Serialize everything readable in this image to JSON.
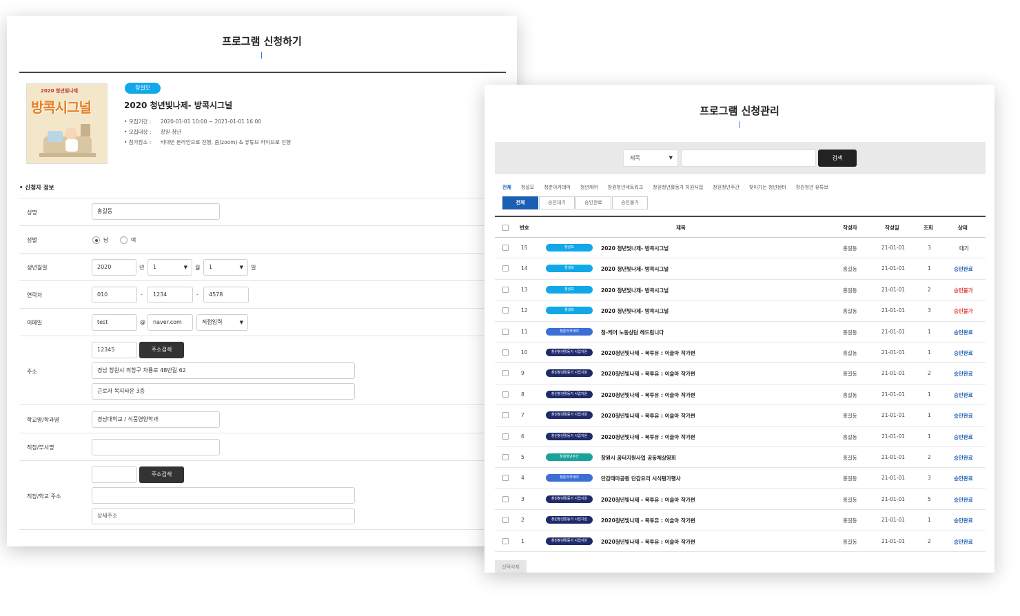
{
  "left": {
    "title": "프로그램 신청하기",
    "thumb_small": "2020 청년빛나제",
    "thumb_main": "방콕시그널",
    "badge": "청설모",
    "program_title": "2020 청년빛나제- 방콕시그널",
    "meta": [
      {
        "key": "모집기간 :",
        "value": "2020-01-01 10:00 ~ 2021-01-01 16:00"
      },
      {
        "key": "모집대상 :",
        "value": "창원 청년"
      },
      {
        "key": "참가장소 :",
        "value": "비대면 온라인으로 진행, 줌(zoom) & 유튜브 라이브로 진행"
      }
    ],
    "section_title": "신청자 정보",
    "labels": {
      "name": "성명",
      "gender": "성별",
      "birth": "생년월일",
      "phone": "연락처",
      "email": "이메일",
      "address": "주소",
      "school": "학교명/학과명",
      "work": "직장/부서명",
      "work_address": "직장/학교 주소"
    },
    "values": {
      "name": "홍길동",
      "gender_male": "남",
      "gender_female": "여",
      "birth_year": "2020",
      "birth_year_unit": "년",
      "birth_month": "1",
      "birth_month_unit": "월",
      "birth_day": "1",
      "birth_day_unit": "일",
      "phone1": "010",
      "phone2": "1234",
      "phone3": "4578",
      "phone_sep": "-",
      "email_id": "test",
      "email_at": "@",
      "email_domain": "naver.com",
      "email_select": "직접입력",
      "zipcode": "12345",
      "address_search": "주소검색",
      "address1": "경남 창원시 의창구 차룡로 48번길 62",
      "address2": "근로자 복지타운 3층",
      "school": "경남대학교 / 식품영양학과",
      "work": "",
      "work_zipcode": "",
      "work_address_search": "주소검색",
      "work_address1": "",
      "work_address2_placeholder": "상세주소"
    }
  },
  "right": {
    "title": "프로그램 신청관리",
    "search_select": "제목",
    "search_button": "검색",
    "categories": [
      "전체",
      "청설모",
      "청춘아카데미",
      "청년케어",
      "창원청년네트워크",
      "창원청년활동가 지원사업",
      "창원청년주간",
      "찾아가는 청년센터",
      "창원청년 유튜브"
    ],
    "status_tabs": [
      "전체",
      "승인대기",
      "승인완료",
      "승인불가"
    ],
    "headers": {
      "no": "번호",
      "title": "제목",
      "author": "작성자",
      "date": "작성일",
      "views": "조회",
      "status": "상태"
    },
    "rows": [
      {
        "no": "15",
        "badge": "청설모",
        "badge_color": "#10a8e8",
        "title": "2020 청년빛나제- 방콕시그널",
        "author": "홍길동",
        "date": "21-01-01",
        "views": "3",
        "status": "대기",
        "status_color": "#555555"
      },
      {
        "no": "14",
        "badge": "청설모",
        "badge_color": "#10a8e8",
        "title": "2020 청년빛나제- 방콕시그널",
        "author": "홍길동",
        "date": "21-01-01",
        "views": "1",
        "status": "승인완료",
        "status_color": "#1a5fb4"
      },
      {
        "no": "13",
        "badge": "청설모",
        "badge_color": "#10a8e8",
        "title": "2020 청년빛나제- 방콕시그널",
        "author": "홍길동",
        "date": "21-01-01",
        "views": "2",
        "status": "승인불가",
        "status_color": "#e53935"
      },
      {
        "no": "12",
        "badge": "청설모",
        "badge_color": "#10a8e8",
        "title": "2020 청년빛나제- 방콕시그널",
        "author": "홍길동",
        "date": "21-01-01",
        "views": "3",
        "status": "승인불가",
        "status_color": "#e53935"
      },
      {
        "no": "11",
        "badge": "청춘아카데미",
        "badge_color": "#3b6fd6",
        "title": "청-케어 노동상담 헤드립니다",
        "author": "홍길동",
        "date": "21-01-01",
        "views": "1",
        "status": "승인완료",
        "status_color": "#1a5fb4"
      },
      {
        "no": "10",
        "badge": "창원청년활동가 사업지원",
        "badge_color": "#1f2a6b",
        "title": "2020청년빛나제 - 북투유 : 이슬아 작가편",
        "author": "홍길동",
        "date": "21-01-01",
        "views": "1",
        "status": "승인완료",
        "status_color": "#1a5fb4"
      },
      {
        "no": "9",
        "badge": "창원청년활동가 사업지원",
        "badge_color": "#1f2a6b",
        "title": "2020청년빛나제 - 북투유 : 이슬아 작가편",
        "author": "홍길동",
        "date": "21-01-01",
        "views": "2",
        "status": "승인완료",
        "status_color": "#1a5fb4"
      },
      {
        "no": "8",
        "badge": "창원청년활동가 사업지원",
        "badge_color": "#1f2a6b",
        "title": "2020청년빛나제 - 북투유 : 이슬아 작가편",
        "author": "홍길동",
        "date": "21-01-01",
        "views": "1",
        "status": "승인완료",
        "status_color": "#1a5fb4"
      },
      {
        "no": "7",
        "badge": "창원청년활동가 사업지원",
        "badge_color": "#1f2a6b",
        "title": "2020청년빛나제 - 북투유 : 이슬아 작가편",
        "author": "홍길동",
        "date": "21-01-01",
        "views": "1",
        "status": "승인완료",
        "status_color": "#1a5fb4"
      },
      {
        "no": "6",
        "badge": "창원청년활동가 사업지원",
        "badge_color": "#1f2a6b",
        "title": "2020청년빛나제 - 북투유 : 이슬아 작가편",
        "author": "홍길동",
        "date": "21-01-01",
        "views": "1",
        "status": "승인완료",
        "status_color": "#1a5fb4"
      },
      {
        "no": "5",
        "badge": "창원청년주간",
        "badge_color": "#1aa39a",
        "title": "창원시 꿈터지원사업 공동체상영회",
        "author": "홍길동",
        "date": "21-01-01",
        "views": "2",
        "status": "승인완료",
        "status_color": "#1a5fb4"
      },
      {
        "no": "4",
        "badge": "청춘아카데미",
        "badge_color": "#3b6fd6",
        "title": "단감테마공원 단감요리 시식평가행사",
        "author": "홍길동",
        "date": "21-01-01",
        "views": "3",
        "status": "승인완료",
        "status_color": "#1a5fb4"
      },
      {
        "no": "3",
        "badge": "창원청년활동가 사업지원",
        "badge_color": "#1f2a6b",
        "title": "2020청년빛나제 - 북투유 : 이슬아 작가편",
        "author": "홍길동",
        "date": "21-01-01",
        "views": "5",
        "status": "승인완료",
        "status_color": "#1a5fb4"
      },
      {
        "no": "2",
        "badge": "창원청년활동가 사업지원",
        "badge_color": "#1f2a6b",
        "title": "2020청년빛나제 - 북투유 : 이슬아 작가편",
        "author": "홍길동",
        "date": "21-01-01",
        "views": "1",
        "status": "승인완료",
        "status_color": "#1a5fb4"
      },
      {
        "no": "1",
        "badge": "창원청년활동가 사업지원",
        "badge_color": "#1f2a6b",
        "title": "2020청년빛나제 - 북투유 : 이슬아 작가편",
        "author": "홍길동",
        "date": "21-01-01",
        "views": "2",
        "status": "승인완료",
        "status_color": "#1a5fb4"
      }
    ],
    "delete_button": "선택삭제"
  }
}
